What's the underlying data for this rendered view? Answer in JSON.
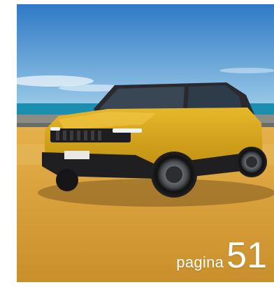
{
  "photo": {
    "subject": "jeep-avenger-suv",
    "colors": {
      "sky_top": "#2f79c6",
      "sky_bottom": "#8cc3e6",
      "sea": "#1c8fb0",
      "ground": "#d9a23a",
      "body_yellow": "#d8a517",
      "trim_black": "#1f1f22"
    }
  },
  "page": {
    "word": "pagina",
    "number": "51"
  }
}
